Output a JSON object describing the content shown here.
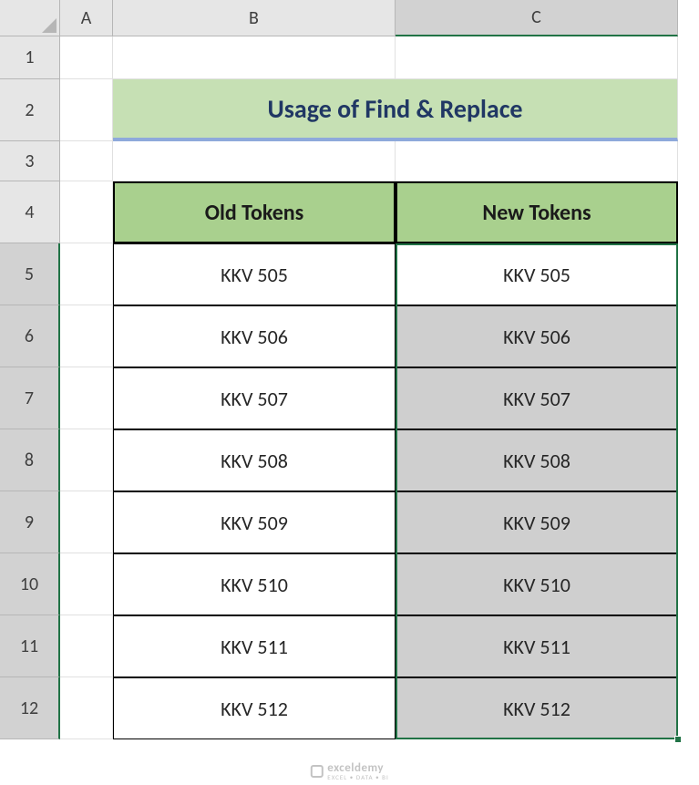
{
  "columns": [
    "A",
    "B",
    "C"
  ],
  "rows": [
    "1",
    "2",
    "3",
    "4",
    "5",
    "6",
    "7",
    "8",
    "9",
    "10",
    "11",
    "12"
  ],
  "title": "Usage of Find & Replace",
  "headers": {
    "old": "Old Tokens",
    "new": "New Tokens"
  },
  "chart_data": {
    "type": "table",
    "title": "Usage of Find & Replace",
    "columns": [
      "Old Tokens",
      "New Tokens"
    ],
    "rows": [
      [
        "KKV 505",
        "KKV 505"
      ],
      [
        "KKV 506",
        "KKV 506"
      ],
      [
        "KKV 507",
        "KKV 507"
      ],
      [
        "KKV 508",
        "KKV 508"
      ],
      [
        "KKV 509",
        "KKV 509"
      ],
      [
        "KKV 510",
        "KKV 510"
      ],
      [
        "KKV 511",
        "KKV 511"
      ],
      [
        "KKV 512",
        "KKV 512"
      ]
    ]
  },
  "watermark": {
    "brand": "exceldemy",
    "sub": "EXCEL • DATA • BI"
  },
  "selection": {
    "active_col": "C",
    "active_rows": [
      "5",
      "6",
      "7",
      "8",
      "9",
      "10",
      "11",
      "12"
    ],
    "active_cell": "C5"
  }
}
